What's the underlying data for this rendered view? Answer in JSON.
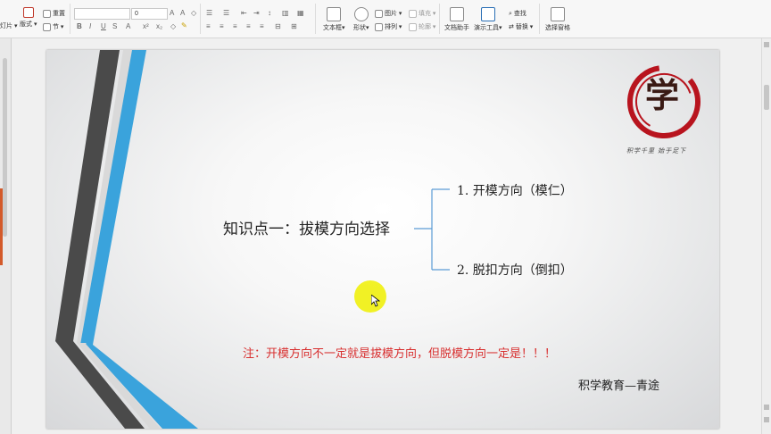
{
  "ribbon": {
    "group1": {
      "layout_label": "版式",
      "prev_label": "灯片"
    },
    "reset_label": "重置",
    "section_label": "节",
    "font_size_value": "0",
    "textbox_label": "文本框",
    "shape_label": "形状",
    "picture_label": "图片",
    "arrange_label": "排列",
    "fill_label": "填充",
    "outline_label": "轮廓",
    "doc_assistant_label": "文档助手",
    "slideshow_tools_label": "演示工具",
    "find_label": "查找",
    "replace_label": "替换",
    "select_pane_label": "选择窗格"
  },
  "slide": {
    "topic": "知识点一：拔模方向选择",
    "branch1": "1. 开模方向（模仁）",
    "branch2": "2. 脱扣方向（倒扣）",
    "note": "注：开模方向不一定就是拔模方向，但脱模方向一定是！！！",
    "footer": "积学教育—青途",
    "logo_char": "学",
    "logo_motto": "积学千里  始于足下"
  },
  "colors": {
    "accent_blue": "#3aa3dc",
    "stripe_dark": "#3b3b3b",
    "note_red": "#d83030",
    "logo_red": "#b8141e"
  }
}
